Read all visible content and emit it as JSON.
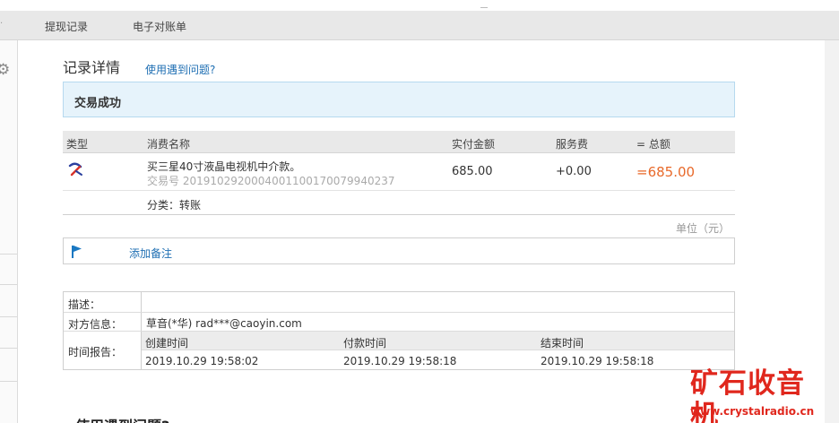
{
  "nav": {
    "items": [
      "提现记录",
      "电子对账单"
    ]
  },
  "page": {
    "title": "记录详情",
    "help_link": "使用遇到问题?",
    "status": "交易成功",
    "unit": "单位（元）",
    "bottom_heading": "使用遇到问题?"
  },
  "table": {
    "headers": [
      "类型",
      "消费名称",
      "实付金额",
      "服务费",
      "= 总额"
    ],
    "row": {
      "name": "买三星40寸液晶电视机中介款。",
      "trade_no": "交易号 2019102920004001100170079940237",
      "paid": "685.00",
      "fee": "+0.00",
      "total": "=685.00"
    },
    "category": "分类：转账"
  },
  "note": {
    "add_label": "添加备注"
  },
  "info": {
    "desc_label": "描述：",
    "desc_value": "",
    "party_label": "对方信息：",
    "party_value": "草音(*华) rad***@caoyin.com",
    "time_label": "时间报告：",
    "time_headers": [
      "创建时间",
      "付款时间",
      "结束时间"
    ],
    "time_values": [
      "2019.10.29 19:58:02",
      "2019.10.29 19:58:18",
      "2019.10.29 19:58:18"
    ]
  },
  "watermark": {
    "main": "矿石收音机",
    "url": "www.crystalradio.cn"
  },
  "colors": {
    "link": "#1f6fb3",
    "total": "#e8692a",
    "status_bg": "#e6f3fb",
    "watermark": "#e0271d"
  },
  "icons": {
    "settings": "gear-icon",
    "type": "transfer-icon",
    "note": "flag-icon"
  }
}
